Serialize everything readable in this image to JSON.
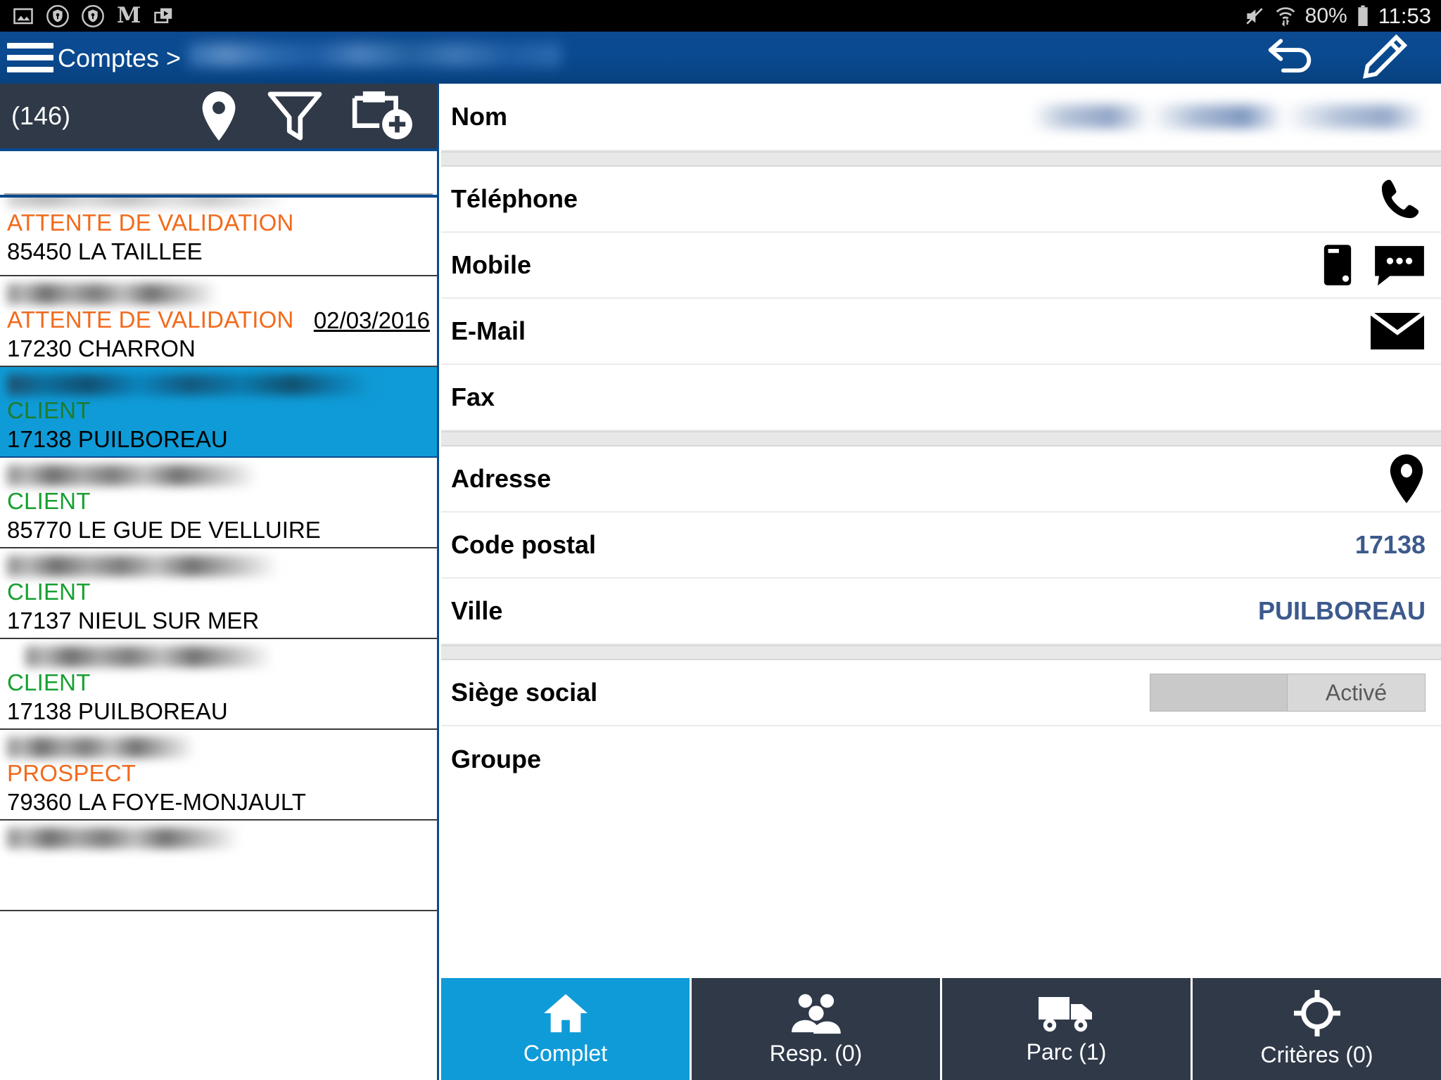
{
  "status_bar": {
    "left_icons": [
      "image-icon",
      "shield-key-icon",
      "shield-key-icon",
      "gothic-m-icon",
      "play-store-icon"
    ],
    "gothic_letter": "M",
    "mute_icon": "speaker-muted-icon",
    "wifi_icon": "wifi-transfer-icon",
    "battery_percent": "80%",
    "battery_icon": "battery-icon",
    "clock": "11:53"
  },
  "app_bar": {
    "menu_icon": "hamburger-menu-icon",
    "breadcrumb_root": "Comptes >",
    "breadcrumb_current": "",
    "undo_icon": "undo-icon",
    "edit_icon": "pencil-edit-icon"
  },
  "list_panel": {
    "count_label": "(146)",
    "map_icon": "map-pin-icon",
    "filter_icon": "filter-funnel-icon",
    "add_icon": "add-account-icon",
    "search_value": "",
    "search_placeholder": "",
    "accounts": [
      {
        "name": "",
        "status": "ATTENTE DE VALIDATION",
        "status_type": "attente",
        "city": "85450 LA TAILLEE",
        "date": "",
        "selected": false,
        "partial": true
      },
      {
        "name": "",
        "status": "ATTENTE DE VALIDATION",
        "status_type": "attente",
        "city": "17230 CHARRON",
        "date": "02/03/2016",
        "selected": false,
        "partial": false
      },
      {
        "name": "",
        "status": "CLIENT",
        "status_type": "client",
        "city": "17138 PUILBOREAU",
        "date": "",
        "selected": true,
        "partial": false
      },
      {
        "name": "",
        "status": "CLIENT",
        "status_type": "client",
        "city": "85770 LE GUE DE VELLUIRE",
        "date": "",
        "selected": false,
        "partial": false
      },
      {
        "name": "",
        "status": "CLIENT",
        "status_type": "client",
        "city": "17137 NIEUL SUR MER",
        "date": "",
        "selected": false,
        "partial": false
      },
      {
        "name": "",
        "status": "CLIENT",
        "status_type": "client",
        "city": "17138 PUILBOREAU",
        "date": "",
        "selected": false,
        "partial": false
      },
      {
        "name": "",
        "status": "PROSPECT",
        "status_type": "prospect",
        "city": "79360 LA FOYE-MONJAULT",
        "date": "",
        "selected": false,
        "partial": false
      }
    ]
  },
  "detail_panel": {
    "fields": [
      {
        "label": "Nom",
        "value": "",
        "kind": "blurred-value"
      },
      {
        "label": "Téléphone",
        "value": "",
        "kind": "icons",
        "icons": [
          "phone-icon"
        ]
      },
      {
        "label": "Mobile",
        "value": "",
        "kind": "icons",
        "icons": [
          "mobile-phone-icon",
          "sms-message-icon"
        ]
      },
      {
        "label": "E-Mail",
        "value": "",
        "kind": "icons",
        "icons": [
          "email-envelope-icon"
        ]
      },
      {
        "label": "Fax",
        "value": "",
        "kind": "plain"
      },
      {
        "label": "Adresse",
        "value": "",
        "kind": "icons",
        "icons": [
          "map-pin-icon"
        ]
      },
      {
        "label": "Code postal",
        "value": "17138",
        "kind": "plain"
      },
      {
        "label": "Ville",
        "value": "PUILBOREAU",
        "kind": "plain"
      },
      {
        "label": "Siège social",
        "value": "Activé",
        "kind": "toggle"
      },
      {
        "label": "Groupe",
        "value": "",
        "kind": "plain"
      }
    ]
  },
  "tab_bar": {
    "tabs": [
      {
        "label": "Complet",
        "icon": "home-icon",
        "active": true
      },
      {
        "label": "Resp.  (0)",
        "icon": "people-icon",
        "active": false
      },
      {
        "label": "Parc  (1)",
        "icon": "truck-icon",
        "active": false
      },
      {
        "label": "Critères  (0)",
        "icon": "target-icon",
        "active": false
      }
    ]
  },
  "colors": {
    "app_bar_blue": "#0a4a90",
    "accent_cyan": "#0f9bd7",
    "toolbar_dark": "#2f3948",
    "status_orange": "#f26a1b",
    "status_green": "#16a030",
    "value_blue": "#3c5a8c"
  }
}
